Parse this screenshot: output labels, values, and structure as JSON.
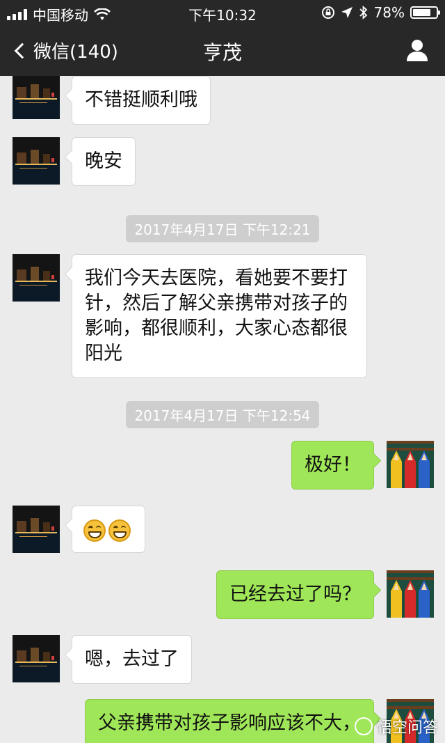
{
  "status_bar": {
    "carrier": "中国移动",
    "time": "下午10:32",
    "battery_text": "78%",
    "battery_level": 0.78,
    "icons": [
      "signal-icon",
      "wifi-icon",
      "lock-rotation-icon",
      "location-icon",
      "bluetooth-icon",
      "battery-icon"
    ]
  },
  "nav": {
    "back_label": "微信(140)",
    "title": "亨茂",
    "right_icon": "user-icon"
  },
  "messages": [
    {
      "side": "in",
      "text": "不错挺顺利哦"
    },
    {
      "side": "in",
      "text": "晚安"
    },
    {
      "type": "time",
      "text": "2017年4月17日 下午12:21"
    },
    {
      "side": "in",
      "text": "我们今天去医院，看她要不要打针，然后了解父亲携带对孩子的影响，都很顺利，大家心态都很阳光"
    },
    {
      "type": "time",
      "text": "2017年4月17日 下午12:54"
    },
    {
      "side": "out",
      "text": "极好！"
    },
    {
      "side": "in",
      "emoji": [
        "grin-emoji",
        "grin-emoji"
      ]
    },
    {
      "side": "out",
      "text": "已经去过了吗？"
    },
    {
      "side": "in",
      "text": "嗯，去过了"
    },
    {
      "side": "out",
      "text": "父亲携带对孩子影响应该不大，"
    }
  ],
  "watermark": "悟空问答",
  "colors": {
    "header": "#282828",
    "background": "#ebebeb",
    "incoming": "#ffffff",
    "outgoing": "#9fe658",
    "timestamp": "#cecece"
  }
}
